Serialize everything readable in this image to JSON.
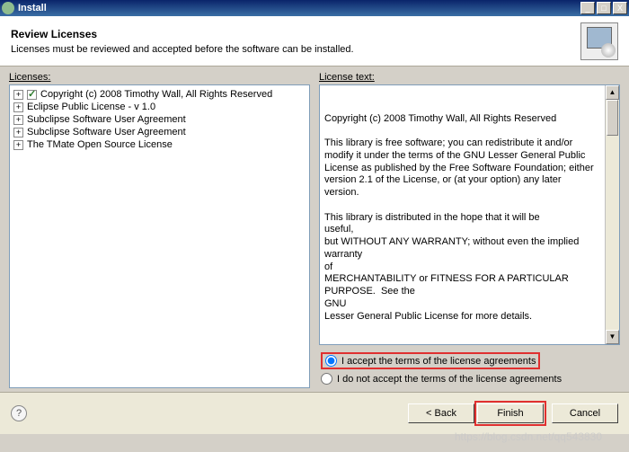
{
  "window": {
    "title": "Install",
    "min": "_",
    "max": "□",
    "close": "X"
  },
  "header": {
    "title": "Review Licenses",
    "subtitle": "Licenses must be reviewed and accepted before the software can be installed."
  },
  "left": {
    "label": "Licenses:",
    "items": [
      {
        "label": "Copyright (c) 2008 Timothy Wall, All Rights Reserved",
        "checked": true
      },
      {
        "label": "Eclipse Public License - v 1.0"
      },
      {
        "label": "Subclipse Software User Agreement"
      },
      {
        "label": "Subclipse Software User Agreement"
      },
      {
        "label": "The TMate Open Source License"
      }
    ]
  },
  "right": {
    "label": "License text:",
    "text": "Copyright (c) 2008 Timothy Wall, All Rights Reserved\n\nThis library is free software; you can redistribute it and/or\nmodify it under the terms of the GNU Lesser General Public\nLicense as published by the Free Software Foundation; either\nversion 2.1 of the License, or (at your option) any later\nversion.\n\nThis library is distributed in the hope that it will be\nuseful,\nbut WITHOUT ANY WARRANTY; without even the implied warranty\nof\nMERCHANTABILITY or FITNESS FOR A PARTICULAR PURPOSE.  See the\nGNU\nLesser General Public License for more details."
  },
  "radios": {
    "accept": "I accept the terms of the license agreements",
    "decline": "I do not accept the terms of the license agreements"
  },
  "buttons": {
    "back": "< Back",
    "finish": "Finish",
    "cancel": "Cancel"
  },
  "help_tip": "?",
  "watermark": "https://blog.csdn.net/qq543830"
}
